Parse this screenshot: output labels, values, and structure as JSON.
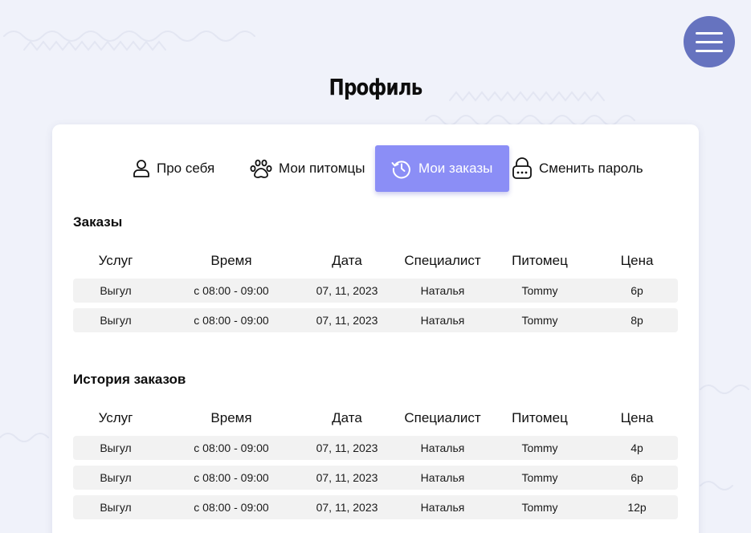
{
  "page": {
    "title": "Профиль"
  },
  "menu": {
    "icon": "hamburger-menu-icon",
    "accent": "#6673bf"
  },
  "tabs": [
    {
      "label": "Про себя",
      "icon": "user-icon",
      "active": false
    },
    {
      "label": "Мои питомцы",
      "icon": "paw-icon",
      "active": false
    },
    {
      "label": "Мои заказы",
      "icon": "history-icon",
      "active": true
    },
    {
      "label": "Сменить пароль",
      "icon": "lock-icon",
      "active": false
    }
  ],
  "colors": {
    "active_tab": "#8b8ef6",
    "background": "#f0f2fa",
    "row": "#f2f2f2"
  },
  "orders": {
    "title": "Заказы",
    "columns": [
      "Услуг",
      "Время",
      "Дата",
      "Специалист",
      "Питомец",
      "Цена"
    ],
    "rows": [
      [
        "Выгул",
        "с 08:00 - 09:00",
        "07, 11, 2023",
        "Наталья",
        "Tommy",
        "6р"
      ],
      [
        "Выгул",
        "с 08:00 - 09:00",
        "07, 11, 2023",
        "Наталья",
        "Tommy",
        "8р"
      ]
    ]
  },
  "history": {
    "title": "История заказов",
    "columns": [
      "Услуг",
      "Время",
      "Дата",
      "Специалист",
      "Питомец",
      "Цена"
    ],
    "rows": [
      [
        "Выгул",
        "с 08:00 - 09:00",
        "07, 11, 2023",
        "Наталья",
        "Tommy",
        "4р"
      ],
      [
        "Выгул",
        "с 08:00 - 09:00",
        "07, 11, 2023",
        "Наталья",
        "Tommy",
        "6р"
      ],
      [
        "Выгул",
        "с 08:00 - 09:00",
        "07, 11, 2023",
        "Наталья",
        "Tommy",
        "12р"
      ]
    ]
  }
}
